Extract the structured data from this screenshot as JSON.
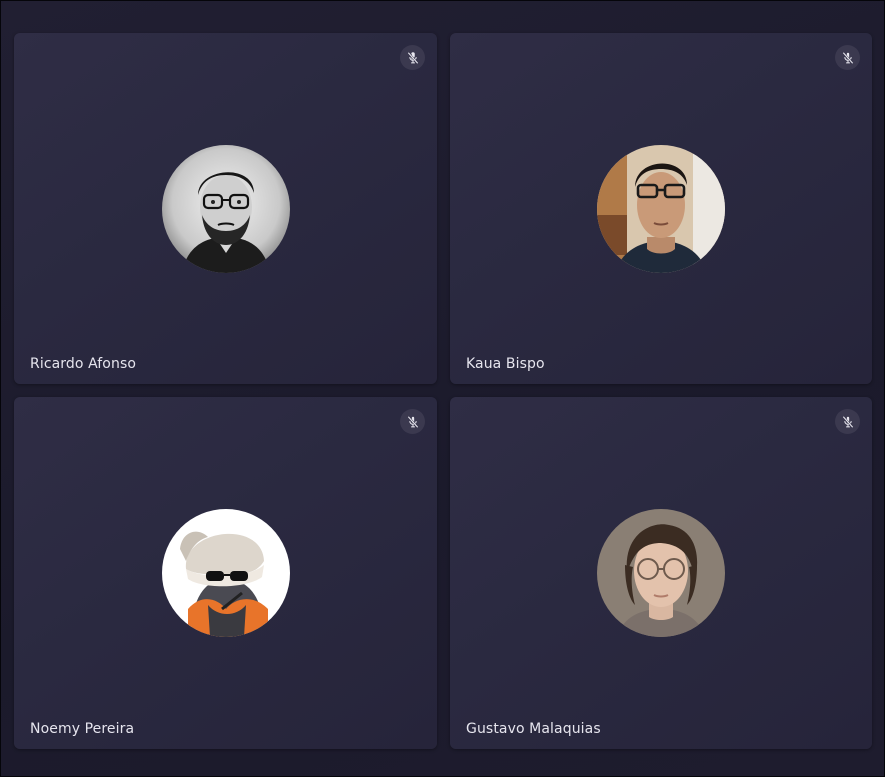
{
  "participants": [
    {
      "name": "Ricardo Afonso",
      "muted": true,
      "avatar": "bw-portrait-bearded-man-glasses"
    },
    {
      "name": "Kaua Bispo",
      "muted": true,
      "avatar": "selfie-young-man-glasses"
    },
    {
      "name": "Noemy Pereira",
      "muted": true,
      "avatar": "cartoon-penguin-chef-hat-sunglasses"
    },
    {
      "name": "Gustavo Malaquias",
      "muted": true,
      "avatar": "portrait-young-man-round-glasses"
    }
  ],
  "icons": {
    "mute": "mic-off-icon"
  },
  "colors": {
    "background": "#1c1b2b",
    "tile": "#2c2a42",
    "mute_badge": "#3b394f",
    "name_text": "#e6e5ee"
  }
}
